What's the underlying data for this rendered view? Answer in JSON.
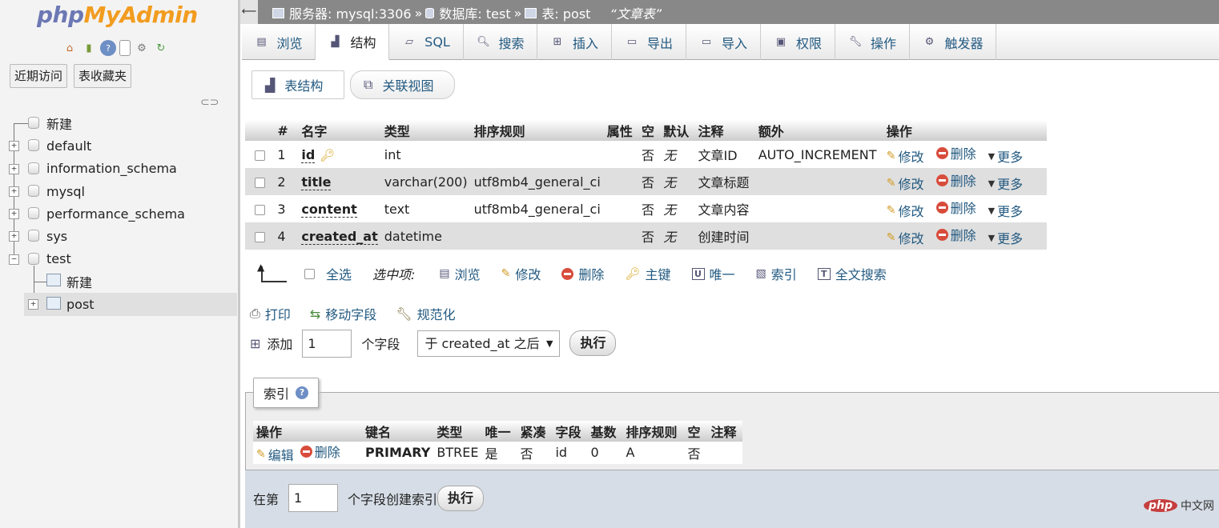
{
  "nav": {
    "logo_php": "php",
    "logo_rest": "MyAdmin",
    "icons": [
      "home-icon",
      "exit-icon",
      "help-icon",
      "docs-icon",
      "settings-icon",
      "reload-icon"
    ],
    "recent_label": "近期访问",
    "favorites_label": "表收藏夹",
    "tree": [
      {
        "label": "新建",
        "kind": "new"
      },
      {
        "label": "default",
        "kind": "db"
      },
      {
        "label": "information_schema",
        "kind": "db"
      },
      {
        "label": "mysql",
        "kind": "db"
      },
      {
        "label": "performance_schema",
        "kind": "db"
      },
      {
        "label": "sys",
        "kind": "db"
      },
      {
        "label": "test",
        "kind": "db-open"
      },
      {
        "label": "新建",
        "kind": "new-table"
      },
      {
        "label": "post",
        "kind": "table"
      }
    ]
  },
  "breadcrumb": {
    "server": "服务器: mysql:3306",
    "database": "数据库: test",
    "table": "表: post",
    "comment": "“文章表”"
  },
  "tabs": [
    {
      "label": "浏览",
      "icon": "browse-icon"
    },
    {
      "label": "结构",
      "icon": "structure-icon",
      "active": true
    },
    {
      "label": "SQL",
      "icon": "sql-icon"
    },
    {
      "label": "搜索",
      "icon": "search-icon"
    },
    {
      "label": "插入",
      "icon": "insert-icon"
    },
    {
      "label": "导出",
      "icon": "export-icon"
    },
    {
      "label": "导入",
      "icon": "import-icon"
    },
    {
      "label": "权限",
      "icon": "privileges-icon"
    },
    {
      "label": "操作",
      "icon": "operations-icon"
    },
    {
      "label": "触发器",
      "icon": "triggers-icon"
    }
  ],
  "subtabs": {
    "table_structure": "表结构",
    "relation_view": "关联视图"
  },
  "structure": {
    "headers": [
      "#",
      "名字",
      "类型",
      "排序规则",
      "属性",
      "空",
      "默认",
      "注释",
      "额外",
      "操作"
    ],
    "rows": [
      {
        "num": "1",
        "name": "id",
        "type": "int",
        "collation": "",
        "attributes": "",
        "null": "否",
        "default": "无",
        "comment": "文章ID",
        "extra": "AUTO_INCREMENT"
      },
      {
        "num": "2",
        "name": "title",
        "type": "varchar(200)",
        "collation": "utf8mb4_general_ci",
        "attributes": "",
        "null": "否",
        "default": "无",
        "comment": "文章标题",
        "extra": ""
      },
      {
        "num": "3",
        "name": "content",
        "type": "text",
        "collation": "utf8mb4_general_ci",
        "attributes": "",
        "null": "否",
        "default": "无",
        "comment": "文章内容",
        "extra": ""
      },
      {
        "num": "4",
        "name": "created_at",
        "type": "datetime",
        "collation": "",
        "attributes": "",
        "null": "否",
        "default": "无",
        "comment": "创建时间",
        "extra": ""
      }
    ],
    "action_edit": "修改",
    "action_drop": "删除",
    "action_more": "更多"
  },
  "selection": {
    "check_all": "全选",
    "with_selected": "选中项:",
    "items": [
      {
        "label": "浏览",
        "icon": "browse-icon"
      },
      {
        "label": "修改",
        "icon": "pencil-icon"
      },
      {
        "label": "删除",
        "icon": "delete-icon"
      },
      {
        "label": "主键",
        "icon": "primary-key-icon"
      },
      {
        "label": "唯一",
        "icon": "unique-icon"
      },
      {
        "label": "索引",
        "icon": "index-icon"
      },
      {
        "label": "全文搜索",
        "icon": "fulltext-icon"
      }
    ]
  },
  "actions": {
    "print": "打印",
    "move_columns": "移动字段",
    "normalize": "规范化"
  },
  "add_columns": {
    "label": "添加",
    "count": "1",
    "unit": "个字段",
    "position": "于 created_at 之后",
    "go": "执行"
  },
  "indexes": {
    "legend": "索引",
    "headers": [
      "操作",
      "键名",
      "类型",
      "唯一",
      "紧凑",
      "字段",
      "基数",
      "排序规则",
      "空",
      "注释"
    ],
    "row": {
      "edit": "编辑",
      "drop": "删除",
      "keyname": "PRIMARY",
      "type": "BTREE",
      "unique": "是",
      "packed": "否",
      "column": "id",
      "cardinality": "0",
      "collation": "A",
      "null": "否",
      "comment": ""
    },
    "create_prefix": "在第",
    "create_count": "1",
    "create_suffix": "个字段创建索引",
    "create_go": "执行"
  },
  "watermark": {
    "php": "php",
    "text": "中文网"
  }
}
